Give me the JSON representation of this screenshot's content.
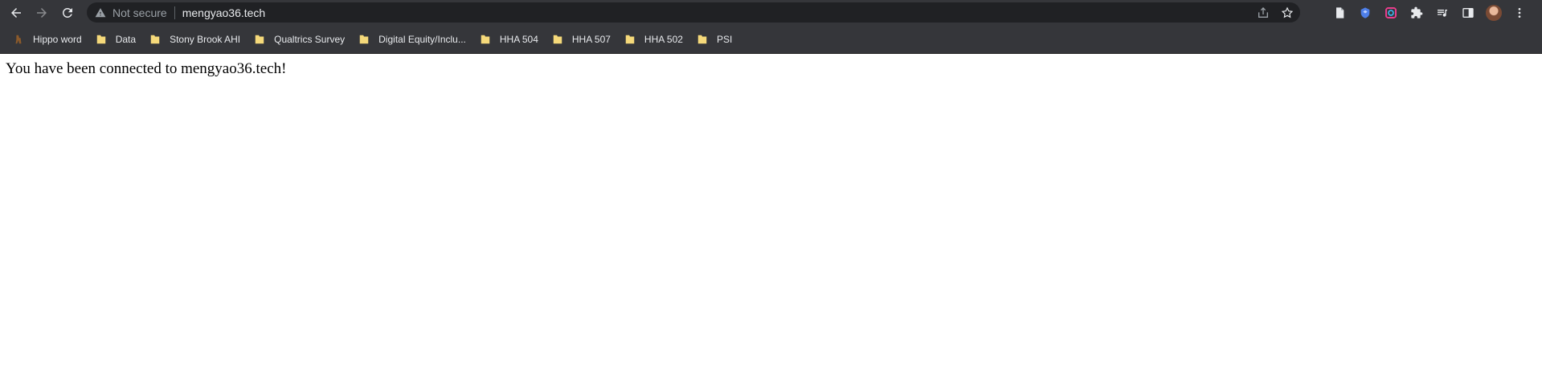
{
  "browser": {
    "security_label": "Not secure",
    "url": "mengyao36.tech"
  },
  "bookmarks": [
    {
      "label": "Hippo word",
      "icon": "hippo-icon"
    },
    {
      "label": "Data",
      "icon": "folder-icon"
    },
    {
      "label": "Stony Brook AHI",
      "icon": "folder-icon"
    },
    {
      "label": "Qualtrics Survey",
      "icon": "folder-icon"
    },
    {
      "label": "Digital Equity/Inclu...",
      "icon": "folder-icon"
    },
    {
      "label": "HHA 504",
      "icon": "folder-icon"
    },
    {
      "label": "HHA 507",
      "icon": "folder-icon"
    },
    {
      "label": "HHA 502",
      "icon": "folder-icon"
    },
    {
      "label": "PSI",
      "icon": "folder-icon"
    }
  ],
  "page": {
    "message": "You have been connected to mengyao36.tech!"
  },
  "colors": {
    "toolbar": "#35363a",
    "omnibox": "#202124",
    "folder": "#f5d97a"
  }
}
